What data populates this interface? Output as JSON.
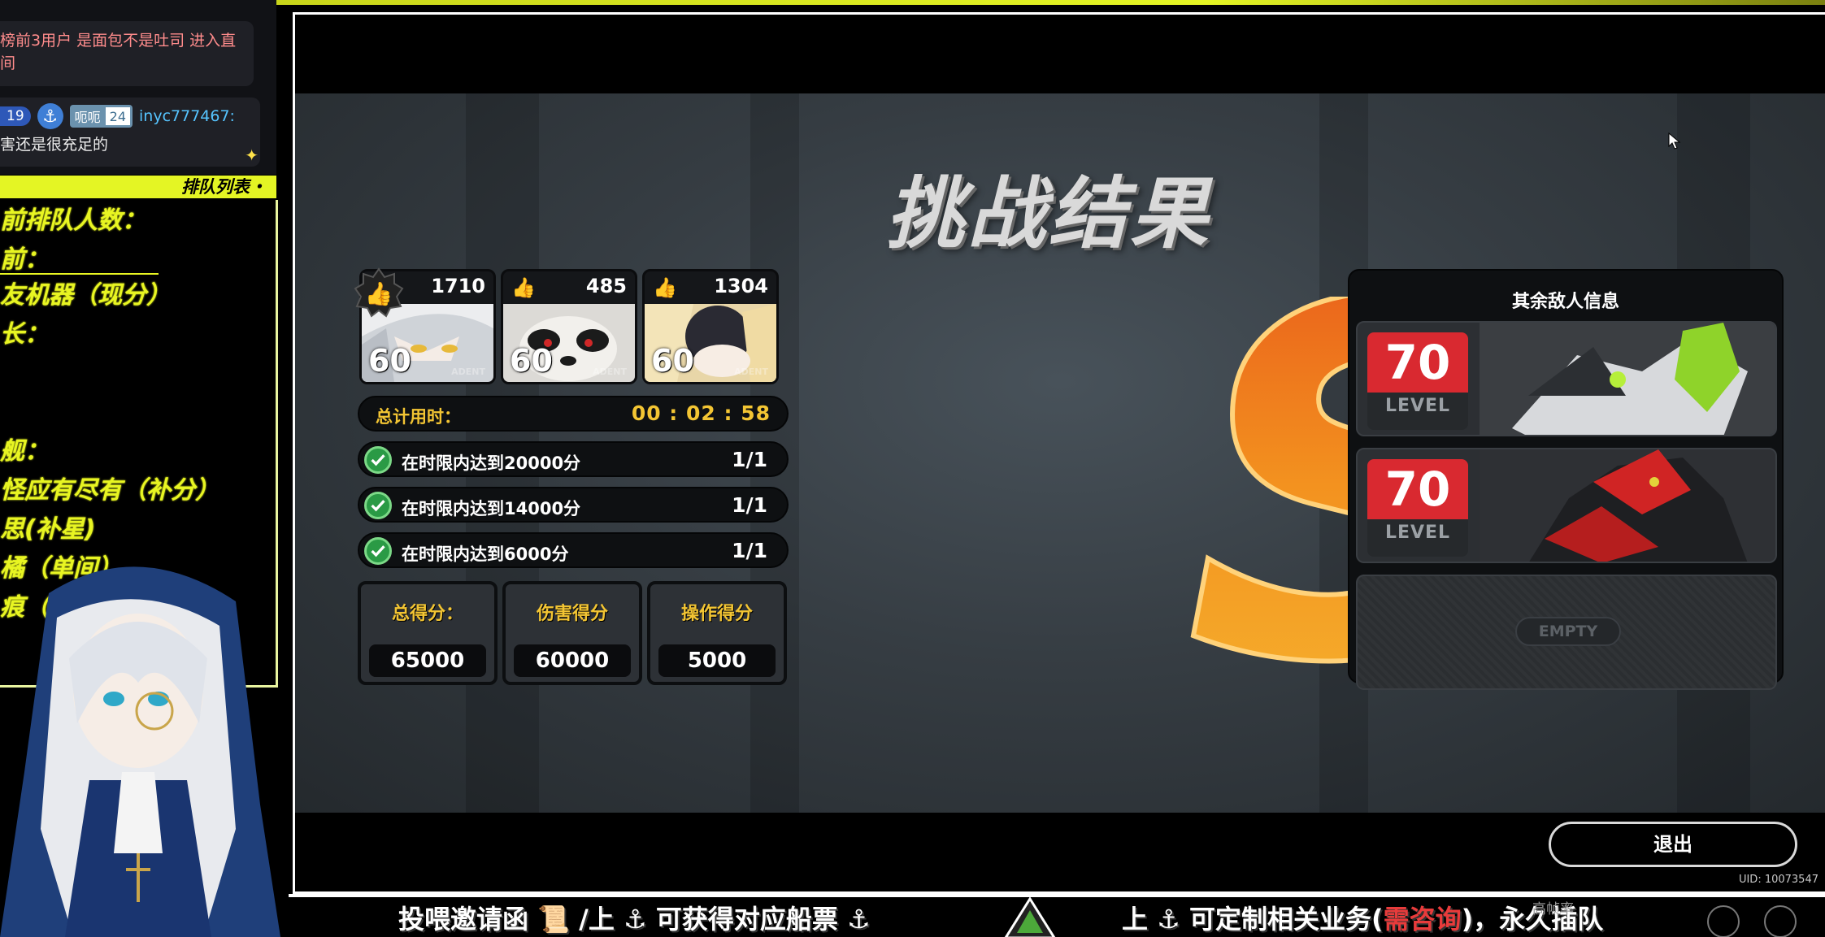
{
  "chat": {
    "message1_line1": "榜前3用户 是面包不是吐司 进入直",
    "message1_line2": "间",
    "message2_badge_count": "19",
    "message2_fan_name": "呃呃",
    "message2_fan_level": "24",
    "message2_user": "inyc777467:",
    "message2_text": "害还是很充足的"
  },
  "queue": {
    "header": "排队列表・",
    "lines": [
      "前排队人数：",
      "前：",
      "友机器（现分）",
      "长：",
      "舰：",
      "怪应有尽有（补分）",
      "思(补星)",
      "橘（单间）",
      "痕（单"
    ]
  },
  "game": {
    "title": "挑战结果",
    "rank": "S",
    "characters": [
      {
        "likes": "1710",
        "level": "60",
        "watermark": "ADENT"
      },
      {
        "likes": "485",
        "level": "60",
        "watermark": "ADENT"
      },
      {
        "likes": "1304",
        "level": "60",
        "watermark": "ADENT"
      }
    ],
    "time_label": "总计用时：",
    "time_value": "00 : 02 : 58",
    "objectives": [
      {
        "text": "在时限内达到20000分",
        "progress": "1/1"
      },
      {
        "text": "在时限内达到14000分",
        "progress": "1/1"
      },
      {
        "text": "在时限内达到6000分",
        "progress": "1/1"
      }
    ],
    "scores": [
      {
        "label": "总得分：",
        "value": "65000"
      },
      {
        "label": "伤害得分",
        "value": "60000"
      },
      {
        "label": "操作得分",
        "value": "5000"
      }
    ],
    "enemy_panel_title": "其余敌人信息",
    "enemies": [
      {
        "level": "70",
        "level_label": "LEVEL"
      },
      {
        "level": "70",
        "level_label": "LEVEL"
      }
    ],
    "empty_label": "EMPTY",
    "exit_label": "退出",
    "uid": "UID: 10073547"
  },
  "banner": {
    "left_a": "投喂邀请函",
    "left_b": "/上",
    "left_c": "可获得对应船票",
    "right_a": "上",
    "right_b": "可定制相关业务(",
    "right_red": "需咨询",
    "right_c": ")，永久插队",
    "ghost_text": "高帧率"
  },
  "colors": {
    "accent_yellow": "#e4f524",
    "score_gold": "#f3c533",
    "level_red": "#d92930",
    "check_green": "#2a9a45"
  }
}
